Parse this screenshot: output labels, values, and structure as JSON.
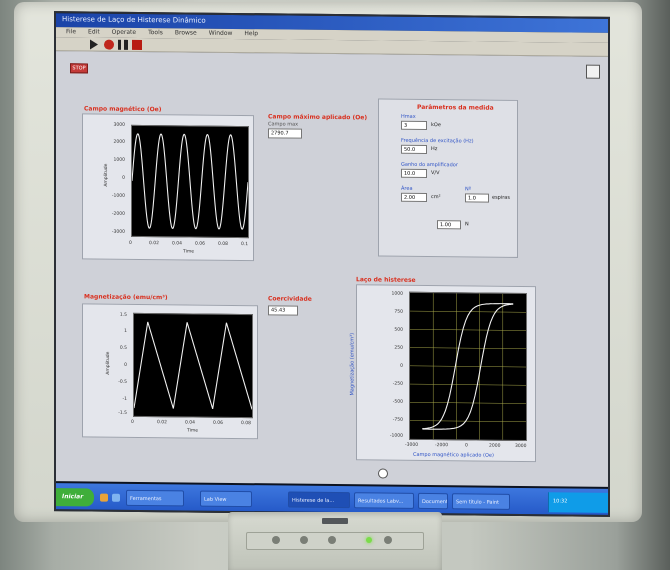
{
  "window": {
    "title": "Histerese de Laço de Histerese Dinâmico",
    "menu": [
      "File",
      "Edit",
      "Operate",
      "Tools",
      "Browse",
      "Window",
      "Help"
    ]
  },
  "controls": {
    "stop_label": "STOP"
  },
  "graph1": {
    "title": "Campo magnético (Oe)",
    "yticks": [
      "3000",
      "2000",
      "1000",
      "0",
      "-1000",
      "-2000",
      "-3000"
    ],
    "xticks": [
      "0",
      "0.02",
      "0.04",
      "0.06",
      "0.08",
      "0.1"
    ],
    "ylabel": "Amplitude",
    "xlabel": "Time"
  },
  "graph1_readout": {
    "title": "Campo máximo aplicado (Oe)",
    "sublabel": "Campo max",
    "value": "2790.7"
  },
  "graph2": {
    "title": "Magnetização (emu/cm³)",
    "yticks": [
      "1.5",
      "1",
      "0.5",
      "0",
      "-0.5",
      "-1",
      "-1.5"
    ],
    "xticks": [
      "0",
      "0.02",
      "0.04",
      "0.06",
      "0.08"
    ],
    "ylabel": "Amplitude",
    "xlabel": "Time"
  },
  "graph2_readout": {
    "title": "Coercividade",
    "value": "45.43"
  },
  "params": {
    "title": "Parâmetros da medida",
    "fields": [
      {
        "label": "Hmax",
        "value": "3",
        "unit": "kOe"
      },
      {
        "label": "Frequência de excitação (Hz)",
        "value": "50.0",
        "unit": "Hz"
      },
      {
        "label": "Ganho do amplificador",
        "value": "10.0",
        "unit": "V/V"
      },
      {
        "label": "Área",
        "value": "2.00",
        "unit": "cm²"
      },
      {
        "label": "Nº",
        "value": "1.0",
        "unit": "espiras"
      },
      {
        "label": "Fator",
        "value": "1.00",
        "unit": "N"
      }
    ]
  },
  "loop": {
    "title": "Laço de histerese",
    "yticks": [
      "1000",
      "750",
      "500",
      "250",
      "0",
      "-250",
      "-500",
      "-750",
      "-1000"
    ],
    "xticks": [
      "-3000",
      "-2000",
      "0",
      "2000",
      "3000"
    ],
    "ylabel": "Magnetização (emu/cm³)",
    "xlabel": "Campo magnético aplicado (Oe)"
  },
  "taskbar": {
    "start_label": "Iniciar",
    "tasks": [
      "Ferramentas",
      "Lab View",
      "Histerese de la...",
      "Resultados Labv...",
      "Documento de...",
      "Sem título - Paint"
    ],
    "clock": "10:32"
  },
  "colors": {
    "trace": "#f2f2f2",
    "grid": "#a8a84a",
    "label_red": "#d9301f",
    "label_blue": "#2f53c6"
  }
}
